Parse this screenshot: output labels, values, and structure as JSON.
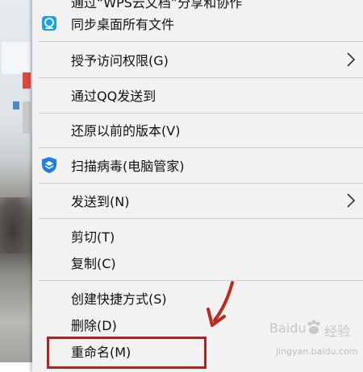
{
  "menu": {
    "items": [
      {
        "label": "通过“WPS云文档”分享和协作"
      },
      {
        "label": "同步桌面所有文件"
      },
      {
        "label": "授予访问权限(G)"
      },
      {
        "label": "通过QQ发送到"
      },
      {
        "label": "还原以前的版本(V)"
      },
      {
        "label": "扫描病毒(电脑管家)"
      },
      {
        "label": "发送到(N)"
      },
      {
        "label": "剪切(T)"
      },
      {
        "label": "复制(C)"
      },
      {
        "label": "创建快捷方式(S)"
      },
      {
        "label": "删除(D)"
      },
      {
        "label": "重命名(M)"
      }
    ]
  },
  "watermark": {
    "brand": "Baidu",
    "product": "经验",
    "url": "jingyan.baidu.com"
  },
  "colors": {
    "menu_background": "#f2f2f2",
    "highlight_border": "#b0231f",
    "annotation_arrow": "#c0281e",
    "qq_icon_blue": "#1aa0e8",
    "shield_icon_blue": "#1f7fe0"
  },
  "icons": {
    "sync": "qq-sync-icon",
    "shield": "tencent-shield-icon",
    "submenu": "chevron-right-icon"
  }
}
